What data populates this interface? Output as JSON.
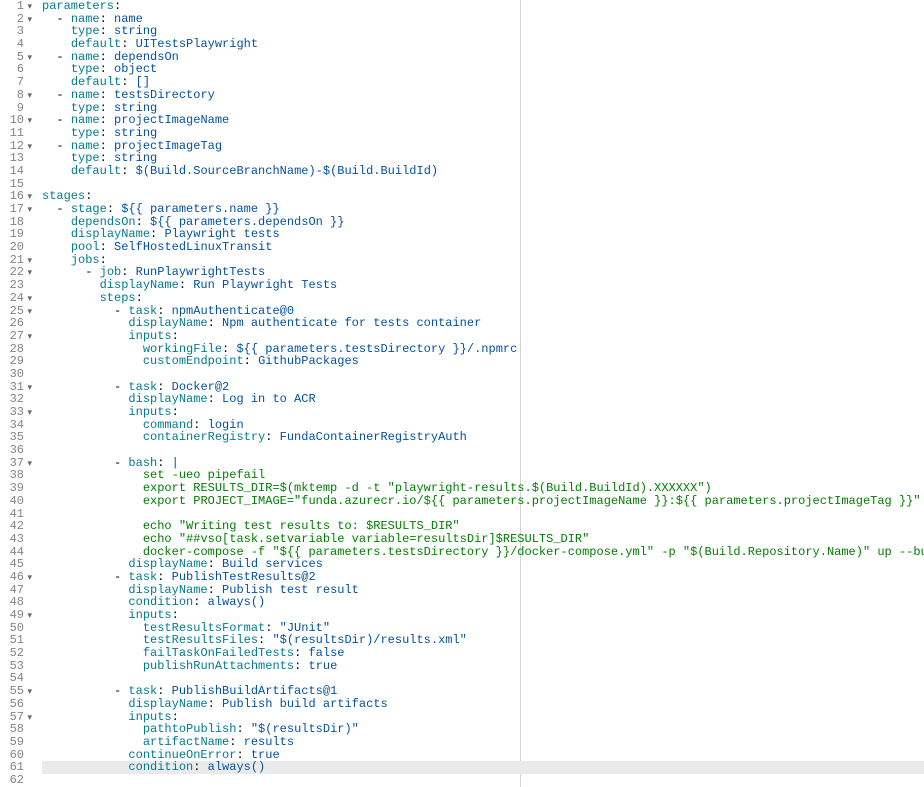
{
  "chart_data": null,
  "lines": [
    {
      "n": 1,
      "fold": true,
      "seg": [
        [
          "key",
          "parameters"
        ],
        [
          "pl",
          ":"
        ]
      ]
    },
    {
      "n": 2,
      "fold": true,
      "seg": [
        [
          "pl",
          "  "
        ],
        [
          "dash",
          "- "
        ],
        [
          "key",
          "name"
        ],
        [
          "pl",
          ": "
        ],
        [
          "bare",
          "name"
        ]
      ]
    },
    {
      "n": 3,
      "seg": [
        [
          "pl",
          "    "
        ],
        [
          "key",
          "type"
        ],
        [
          "pl",
          ": "
        ],
        [
          "bare",
          "string"
        ]
      ]
    },
    {
      "n": 4,
      "seg": [
        [
          "pl",
          "    "
        ],
        [
          "key",
          "default"
        ],
        [
          "pl",
          ": "
        ],
        [
          "bare",
          "UITestsPlaywright"
        ]
      ]
    },
    {
      "n": 5,
      "fold": true,
      "seg": [
        [
          "pl",
          "  "
        ],
        [
          "dash",
          "- "
        ],
        [
          "key",
          "name"
        ],
        [
          "pl",
          ": "
        ],
        [
          "bare",
          "dependsOn"
        ]
      ]
    },
    {
      "n": 6,
      "seg": [
        [
          "pl",
          "    "
        ],
        [
          "key",
          "type"
        ],
        [
          "pl",
          ": "
        ],
        [
          "bare",
          "object"
        ]
      ]
    },
    {
      "n": 7,
      "seg": [
        [
          "pl",
          "    "
        ],
        [
          "key",
          "default"
        ],
        [
          "pl",
          ": "
        ],
        [
          "bare",
          "[]"
        ]
      ]
    },
    {
      "n": 8,
      "fold": true,
      "seg": [
        [
          "pl",
          "  "
        ],
        [
          "dash",
          "- "
        ],
        [
          "key",
          "name"
        ],
        [
          "pl",
          ": "
        ],
        [
          "bare",
          "testsDirectory"
        ]
      ]
    },
    {
      "n": 9,
      "seg": [
        [
          "pl",
          "    "
        ],
        [
          "key",
          "type"
        ],
        [
          "pl",
          ": "
        ],
        [
          "bare",
          "string"
        ]
      ]
    },
    {
      "n": 10,
      "fold": true,
      "seg": [
        [
          "pl",
          "  "
        ],
        [
          "dash",
          "- "
        ],
        [
          "key",
          "name"
        ],
        [
          "pl",
          ": "
        ],
        [
          "bare",
          "projectImageName"
        ]
      ]
    },
    {
      "n": 11,
      "seg": [
        [
          "pl",
          "    "
        ],
        [
          "key",
          "type"
        ],
        [
          "pl",
          ": "
        ],
        [
          "bare",
          "string"
        ]
      ]
    },
    {
      "n": 12,
      "fold": true,
      "seg": [
        [
          "pl",
          "  "
        ],
        [
          "dash",
          "- "
        ],
        [
          "key",
          "name"
        ],
        [
          "pl",
          ": "
        ],
        [
          "bare",
          "projectImageTag"
        ]
      ]
    },
    {
      "n": 13,
      "seg": [
        [
          "pl",
          "    "
        ],
        [
          "key",
          "type"
        ],
        [
          "pl",
          ": "
        ],
        [
          "bare",
          "string"
        ]
      ]
    },
    {
      "n": 14,
      "seg": [
        [
          "pl",
          "    "
        ],
        [
          "key",
          "default"
        ],
        [
          "pl",
          ": "
        ],
        [
          "bare",
          "$(Build.SourceBranchName)-$(Build.BuildId)"
        ]
      ]
    },
    {
      "n": 15,
      "seg": [
        [
          "pl",
          ""
        ]
      ]
    },
    {
      "n": 16,
      "fold": true,
      "seg": [
        [
          "key",
          "stages"
        ],
        [
          "pl",
          ":"
        ]
      ]
    },
    {
      "n": 17,
      "fold": true,
      "seg": [
        [
          "pl",
          "  "
        ],
        [
          "dash",
          "- "
        ],
        [
          "key",
          "stage"
        ],
        [
          "pl",
          ": "
        ],
        [
          "bare",
          "${{ parameters.name }}"
        ]
      ]
    },
    {
      "n": 18,
      "seg": [
        [
          "pl",
          "    "
        ],
        [
          "key",
          "dependsOn"
        ],
        [
          "pl",
          ": "
        ],
        [
          "bare",
          "${{ parameters.dependsOn }}"
        ]
      ]
    },
    {
      "n": 19,
      "seg": [
        [
          "pl",
          "    "
        ],
        [
          "key",
          "displayName"
        ],
        [
          "pl",
          ": "
        ],
        [
          "bare",
          "Playwright tests"
        ]
      ]
    },
    {
      "n": 20,
      "seg": [
        [
          "pl",
          "    "
        ],
        [
          "key",
          "pool"
        ],
        [
          "pl",
          ": "
        ],
        [
          "bare",
          "SelfHostedLinuxTransit"
        ]
      ]
    },
    {
      "n": 21,
      "fold": true,
      "seg": [
        [
          "pl",
          "    "
        ],
        [
          "key",
          "jobs"
        ],
        [
          "pl",
          ":"
        ]
      ]
    },
    {
      "n": 22,
      "fold": true,
      "seg": [
        [
          "pl",
          "      "
        ],
        [
          "dash",
          "- "
        ],
        [
          "key",
          "job"
        ],
        [
          "pl",
          ": "
        ],
        [
          "bare",
          "RunPlaywrightTests"
        ]
      ]
    },
    {
      "n": 23,
      "seg": [
        [
          "pl",
          "        "
        ],
        [
          "key",
          "displayName"
        ],
        [
          "pl",
          ": "
        ],
        [
          "bare",
          "Run Playwright Tests"
        ]
      ]
    },
    {
      "n": 24,
      "fold": true,
      "seg": [
        [
          "pl",
          "        "
        ],
        [
          "key",
          "steps"
        ],
        [
          "pl",
          ":"
        ]
      ]
    },
    {
      "n": 25,
      "fold": true,
      "seg": [
        [
          "pl",
          "          "
        ],
        [
          "dash",
          "- "
        ],
        [
          "key",
          "task"
        ],
        [
          "pl",
          ": "
        ],
        [
          "bare",
          "npmAuthenticate@0"
        ]
      ]
    },
    {
      "n": 26,
      "seg": [
        [
          "pl",
          "            "
        ],
        [
          "key",
          "displayName"
        ],
        [
          "pl",
          ": "
        ],
        [
          "bare",
          "Npm authenticate for tests container"
        ]
      ]
    },
    {
      "n": 27,
      "fold": true,
      "seg": [
        [
          "pl",
          "            "
        ],
        [
          "key",
          "inputs"
        ],
        [
          "pl",
          ":"
        ]
      ]
    },
    {
      "n": 28,
      "seg": [
        [
          "pl",
          "              "
        ],
        [
          "key",
          "workingFile"
        ],
        [
          "pl",
          ": "
        ],
        [
          "bare",
          "${{ parameters.testsDirectory }}/.npmrc"
        ]
      ]
    },
    {
      "n": 29,
      "seg": [
        [
          "pl",
          "              "
        ],
        [
          "key",
          "customEndpoint"
        ],
        [
          "pl",
          ": "
        ],
        [
          "bare",
          "GithubPackages"
        ]
      ]
    },
    {
      "n": 30,
      "seg": [
        [
          "pl",
          ""
        ]
      ]
    },
    {
      "n": 31,
      "fold": true,
      "seg": [
        [
          "pl",
          "          "
        ],
        [
          "dash",
          "- "
        ],
        [
          "key",
          "task"
        ],
        [
          "pl",
          ": "
        ],
        [
          "bare",
          "Docker@2"
        ]
      ]
    },
    {
      "n": 32,
      "seg": [
        [
          "pl",
          "            "
        ],
        [
          "key",
          "displayName"
        ],
        [
          "pl",
          ": "
        ],
        [
          "bare",
          "Log in to ACR"
        ]
      ]
    },
    {
      "n": 33,
      "fold": true,
      "seg": [
        [
          "pl",
          "            "
        ],
        [
          "key",
          "inputs"
        ],
        [
          "pl",
          ":"
        ]
      ]
    },
    {
      "n": 34,
      "seg": [
        [
          "pl",
          "              "
        ],
        [
          "key",
          "command"
        ],
        [
          "pl",
          ": "
        ],
        [
          "bare",
          "login"
        ]
      ]
    },
    {
      "n": 35,
      "seg": [
        [
          "pl",
          "              "
        ],
        [
          "key",
          "containerRegistry"
        ],
        [
          "pl",
          ": "
        ],
        [
          "bare",
          "FundaContainerRegistryAuth"
        ]
      ]
    },
    {
      "n": 36,
      "seg": [
        [
          "pl",
          ""
        ]
      ]
    },
    {
      "n": 37,
      "fold": true,
      "seg": [
        [
          "pl",
          "          "
        ],
        [
          "dash",
          "- "
        ],
        [
          "key",
          "bash"
        ],
        [
          "pl",
          ": "
        ],
        [
          "bare",
          "|"
        ]
      ]
    },
    {
      "n": 38,
      "seg": [
        [
          "pl",
          "              "
        ],
        [
          "cmt",
          "set -ueo pipefail"
        ]
      ]
    },
    {
      "n": 39,
      "seg": [
        [
          "pl",
          "              "
        ],
        [
          "cmt",
          "export RESULTS_DIR=$(mktemp -d -t \"playwright-results.$(Build.BuildId).XXXXXX\")"
        ]
      ]
    },
    {
      "n": 40,
      "seg": [
        [
          "pl",
          "              "
        ],
        [
          "cmt",
          "export PROJECT_IMAGE=\"funda.azurecr.io/${{ parameters.projectImageName }}:${{ parameters.projectImageTag }}\""
        ]
      ]
    },
    {
      "n": 41,
      "seg": [
        [
          "pl",
          ""
        ]
      ]
    },
    {
      "n": 42,
      "seg": [
        [
          "pl",
          "              "
        ],
        [
          "cmt",
          "echo \"Writing test results to: $RESULTS_DIR\""
        ]
      ]
    },
    {
      "n": 43,
      "seg": [
        [
          "pl",
          "              "
        ],
        [
          "cmt",
          "echo \"##vso[task.setvariable variable=resultsDir]$RESULTS_DIR\""
        ]
      ]
    },
    {
      "n": 44,
      "seg": [
        [
          "pl",
          "              "
        ],
        [
          "cmt",
          "docker-compose -f \"${{ parameters.testsDirectory }}/docker-compose.yml\" -p \"$(Build.Repository.Name)\" up --build --abort-on-container-exit"
        ]
      ]
    },
    {
      "n": 45,
      "seg": [
        [
          "pl",
          "            "
        ],
        [
          "key",
          "displayName"
        ],
        [
          "pl",
          ": "
        ],
        [
          "bare",
          "Build services"
        ]
      ]
    },
    {
      "n": 46,
      "fold": true,
      "seg": [
        [
          "pl",
          "          "
        ],
        [
          "dash",
          "- "
        ],
        [
          "key",
          "task"
        ],
        [
          "pl",
          ": "
        ],
        [
          "bare",
          "PublishTestResults@2"
        ]
      ]
    },
    {
      "n": 47,
      "seg": [
        [
          "pl",
          "            "
        ],
        [
          "key",
          "displayName"
        ],
        [
          "pl",
          ": "
        ],
        [
          "bare",
          "Publish test result"
        ]
      ]
    },
    {
      "n": 48,
      "seg": [
        [
          "pl",
          "            "
        ],
        [
          "key",
          "condition"
        ],
        [
          "pl",
          ": "
        ],
        [
          "bare",
          "always()"
        ]
      ]
    },
    {
      "n": 49,
      "fold": true,
      "seg": [
        [
          "pl",
          "            "
        ],
        [
          "key",
          "inputs"
        ],
        [
          "pl",
          ":"
        ]
      ]
    },
    {
      "n": 50,
      "seg": [
        [
          "pl",
          "              "
        ],
        [
          "key",
          "testResultsFormat"
        ],
        [
          "pl",
          ": "
        ],
        [
          "str",
          "\"JUnit\""
        ]
      ]
    },
    {
      "n": 51,
      "seg": [
        [
          "pl",
          "              "
        ],
        [
          "key",
          "testResultsFiles"
        ],
        [
          "pl",
          ": "
        ],
        [
          "str",
          "\"$(resultsDir)/results.xml\""
        ]
      ]
    },
    {
      "n": 52,
      "seg": [
        [
          "pl",
          "              "
        ],
        [
          "key",
          "failTaskOnFailedTests"
        ],
        [
          "pl",
          ": "
        ],
        [
          "bool",
          "false"
        ]
      ]
    },
    {
      "n": 53,
      "seg": [
        [
          "pl",
          "              "
        ],
        [
          "key",
          "publishRunAttachments"
        ],
        [
          "pl",
          ": "
        ],
        [
          "bool",
          "true"
        ]
      ]
    },
    {
      "n": 54,
      "seg": [
        [
          "pl",
          ""
        ]
      ]
    },
    {
      "n": 55,
      "fold": true,
      "seg": [
        [
          "pl",
          "          "
        ],
        [
          "dash",
          "- "
        ],
        [
          "key",
          "task"
        ],
        [
          "pl",
          ": "
        ],
        [
          "bare",
          "PublishBuildArtifacts@1"
        ]
      ]
    },
    {
      "n": 56,
      "seg": [
        [
          "pl",
          "            "
        ],
        [
          "key",
          "displayName"
        ],
        [
          "pl",
          ": "
        ],
        [
          "bare",
          "Publish build artifacts"
        ]
      ]
    },
    {
      "n": 57,
      "fold": true,
      "seg": [
        [
          "pl",
          "            "
        ],
        [
          "key",
          "inputs"
        ],
        [
          "pl",
          ":"
        ]
      ]
    },
    {
      "n": 58,
      "seg": [
        [
          "pl",
          "              "
        ],
        [
          "key",
          "pathtoPublish"
        ],
        [
          "pl",
          ": "
        ],
        [
          "str",
          "\"$(resultsDir)\""
        ]
      ]
    },
    {
      "n": 59,
      "seg": [
        [
          "pl",
          "              "
        ],
        [
          "key",
          "artifactName"
        ],
        [
          "pl",
          ": "
        ],
        [
          "bare",
          "results"
        ]
      ]
    },
    {
      "n": 60,
      "seg": [
        [
          "pl",
          "            "
        ],
        [
          "key",
          "continueOnError"
        ],
        [
          "pl",
          ": "
        ],
        [
          "bool",
          "true"
        ]
      ]
    },
    {
      "n": 61,
      "hl": true,
      "seg": [
        [
          "pl",
          "            "
        ],
        [
          "key",
          "condition"
        ],
        [
          "pl",
          ": "
        ],
        [
          "bare",
          "always()"
        ]
      ]
    },
    {
      "n": 62,
      "seg": [
        [
          "pl",
          ""
        ]
      ]
    }
  ]
}
